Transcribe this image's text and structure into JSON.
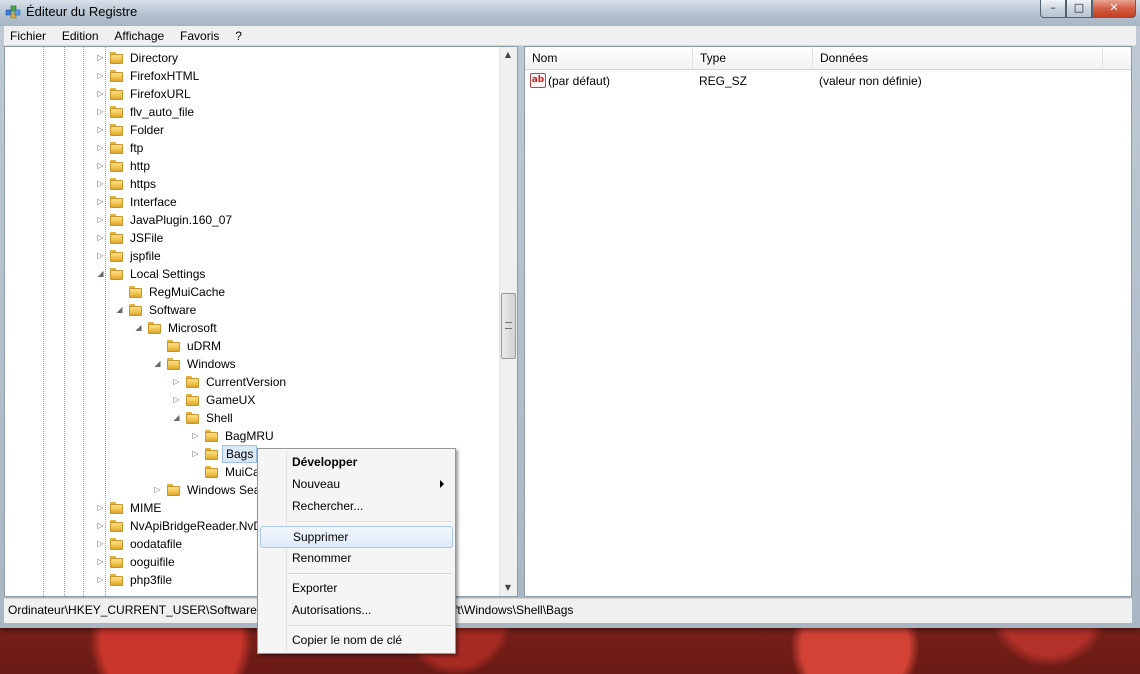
{
  "window": {
    "title": "Éditeur du Registre",
    "caption": {
      "minimize": "–",
      "maximize": "□",
      "close": "✕"
    }
  },
  "menu": [
    "Fichier",
    "Edition",
    "Affichage",
    "Favoris",
    "?"
  ],
  "tree": {
    "items": [
      {
        "label": "Directory",
        "expander": "▷"
      },
      {
        "label": "FirefoxHTML",
        "expander": "▷"
      },
      {
        "label": "FirefoxURL",
        "expander": "▷"
      },
      {
        "label": "flv_auto_file",
        "expander": "▷"
      },
      {
        "label": "Folder",
        "expander": "▷"
      },
      {
        "label": "ftp",
        "expander": "▷"
      },
      {
        "label": "http",
        "expander": "▷"
      },
      {
        "label": "https",
        "expander": "▷"
      },
      {
        "label": "Interface",
        "expander": "▷"
      },
      {
        "label": "JavaPlugin.160_07",
        "expander": "▷"
      },
      {
        "label": "JSFile",
        "expander": "▷"
      },
      {
        "label": "jspfile",
        "expander": "▷"
      },
      {
        "label": "Local Settings",
        "expander": "◢"
      },
      {
        "label": "RegMuiCache",
        "expander": ""
      },
      {
        "label": "Software",
        "expander": "◢"
      },
      {
        "label": "Microsoft",
        "expander": "◢"
      },
      {
        "label": "uDRM",
        "expander": ""
      },
      {
        "label": "Windows",
        "expander": "◢"
      },
      {
        "label": "CurrentVersion",
        "expander": "▷"
      },
      {
        "label": "GameUX",
        "expander": "▷"
      },
      {
        "label": "Shell",
        "expander": "◢"
      },
      {
        "label": "BagMRU",
        "expander": "▷"
      },
      {
        "label": "Bags",
        "expander": "▷"
      },
      {
        "label": "MuiCa",
        "expander": ""
      },
      {
        "label": "Windows Sear",
        "expander": "▷"
      },
      {
        "label": "MIME",
        "expander": "▷"
      },
      {
        "label": "NvApiBridgeReader.NvDr",
        "expander": "▷"
      },
      {
        "label": "oodatafile",
        "expander": "▷"
      },
      {
        "label": "ooguifile",
        "expander": "▷"
      },
      {
        "label": "php3file",
        "expander": "▷"
      }
    ],
    "scroll": {
      "up": "▲",
      "down": "▼"
    }
  },
  "list": {
    "columns": [
      "Nom",
      "Type",
      "Données"
    ],
    "rows": [
      {
        "icon": "ab",
        "name": "(par défaut)",
        "type": "REG_SZ",
        "data": "(valeur non définie)"
      }
    ]
  },
  "status": {
    "path": "Ordinateur\\HKEY_CURRENT_USER\\Software\\Cla",
    "path_tail": "ft\\Windows\\Shell\\Bags"
  },
  "context_menu": {
    "items": [
      {
        "label": "Développer"
      },
      {
        "label": "Nouveau"
      },
      {
        "label": "Rechercher..."
      },
      {
        "label": "Supprimer"
      },
      {
        "label": "Renommer"
      },
      {
        "label": "Exporter"
      },
      {
        "label": "Autorisations..."
      },
      {
        "label": "Copier le nom de clé"
      }
    ]
  }
}
